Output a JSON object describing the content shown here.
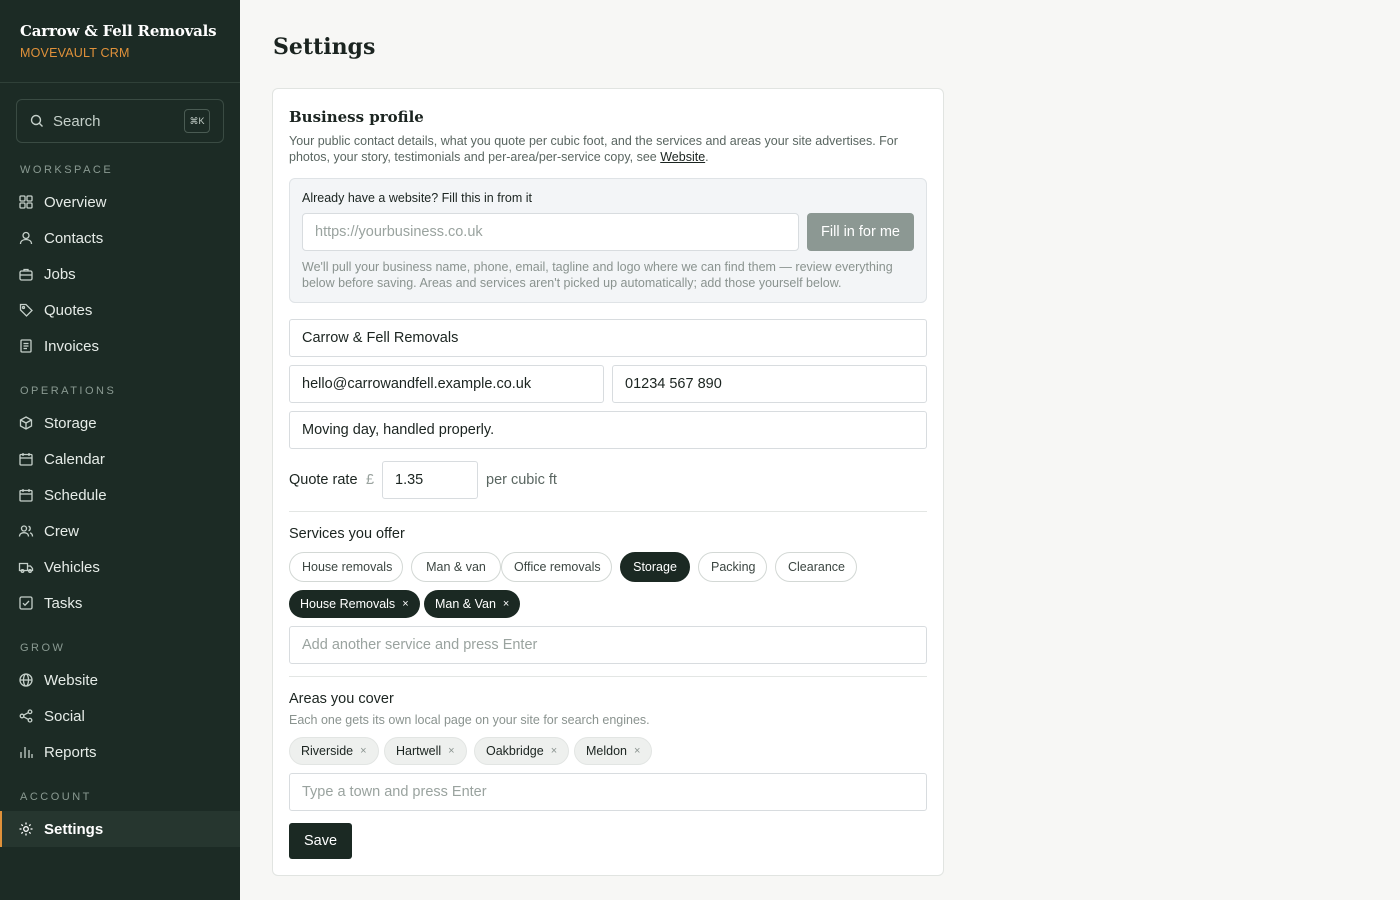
{
  "brand": {
    "name": "Carrow & Fell Removals",
    "product": "MOVEVAULT CRM",
    "accent": "#e0913a"
  },
  "search": {
    "label": "Search",
    "shortcut": "⌘K"
  },
  "nav": {
    "workspace_label": "WORKSPACE",
    "workspace": [
      {
        "label": "Overview",
        "icon": "grid-icon"
      },
      {
        "label": "Contacts",
        "icon": "user-icon"
      },
      {
        "label": "Jobs",
        "icon": "briefcase-icon"
      },
      {
        "label": "Quotes",
        "icon": "tag-icon"
      },
      {
        "label": "Invoices",
        "icon": "document-icon"
      }
    ],
    "operations_label": "OPERATIONS",
    "operations": [
      {
        "label": "Storage",
        "icon": "box-icon"
      },
      {
        "label": "Calendar",
        "icon": "calendar-icon"
      },
      {
        "label": "Schedule",
        "icon": "calendar-icon"
      },
      {
        "label": "Crew",
        "icon": "users-icon"
      },
      {
        "label": "Vehicles",
        "icon": "truck-icon"
      },
      {
        "label": "Tasks",
        "icon": "checkbox-icon"
      }
    ],
    "grow_label": "GROW",
    "grow": [
      {
        "label": "Website",
        "icon": "globe-icon"
      },
      {
        "label": "Social",
        "icon": "share-icon"
      },
      {
        "label": "Reports",
        "icon": "bar-chart-icon"
      }
    ],
    "account_label": "ACCOUNT",
    "account": [
      {
        "label": "Settings",
        "icon": "gear-icon",
        "active": true
      }
    ]
  },
  "page": {
    "title": "Settings"
  },
  "profile": {
    "title": "Business profile",
    "description": "Your public contact details, what you quote per cubic foot, and the services and areas your site advertises. For photos, your story, testimonials and per-area/per-service copy, see ",
    "description_link": "Website",
    "description_end": ".",
    "import": {
      "title": "Already have a website? Fill this in from it",
      "url_placeholder": "https://yourbusiness.co.uk",
      "button": "Fill in for me",
      "note": "We'll pull your business name, phone, email, tagline and logo where we can find them — review everything below before saving. Areas and services aren't picked up automatically; add those yourself below."
    },
    "business_name": "Carrow & Fell Removals",
    "email": "hello@carrowandfell.example.co.uk",
    "phone": "01234 567 890",
    "tagline": "Moving day, handled properly.",
    "rate": {
      "label": "Quote rate",
      "currency": "£",
      "value": "1.35",
      "unit": "per cubic ft"
    },
    "services": {
      "title": "Services you offer",
      "options": [
        {
          "label": "House removals",
          "selected": false
        },
        {
          "label": "Man & van",
          "selected": false
        },
        {
          "label": "Office removals",
          "selected": false
        },
        {
          "label": "Storage",
          "selected": true
        },
        {
          "label": "Packing",
          "selected": false
        },
        {
          "label": "Clearance",
          "selected": false
        }
      ],
      "custom": [
        "House Removals",
        "Man & Van"
      ],
      "placeholder": "Add another service and press Enter"
    },
    "areas": {
      "title": "Areas you cover",
      "help": "Each one gets its own local page on your site for search engines.",
      "items": [
        "Riverside",
        "Hartwell",
        "Oakbridge",
        "Meldon"
      ],
      "placeholder": "Type a town and press Enter"
    },
    "save": "Save",
    "remove_glyph": "×"
  }
}
